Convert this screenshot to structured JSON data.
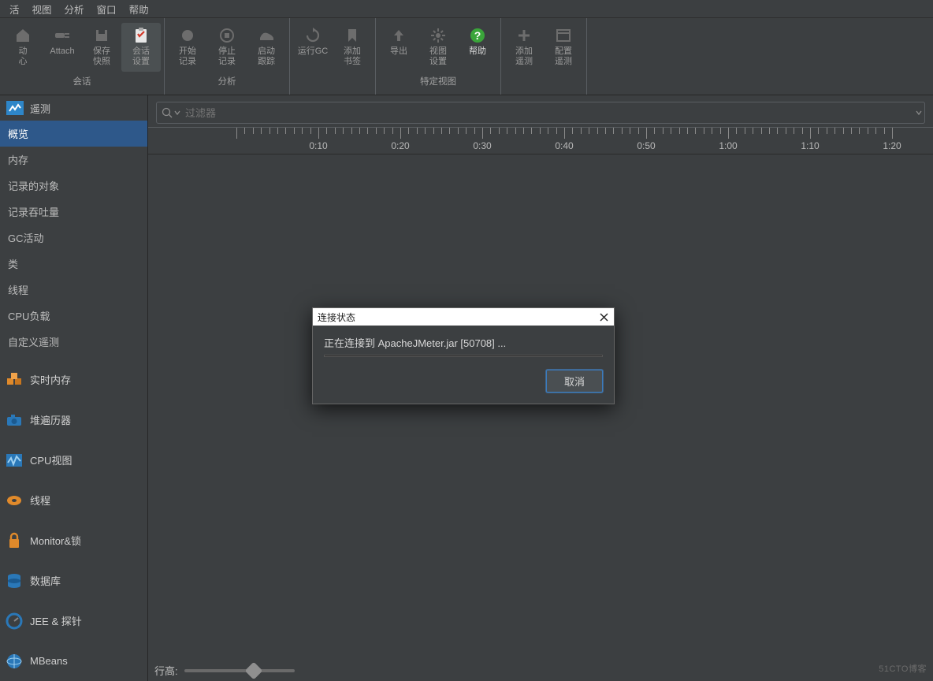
{
  "menu": {
    "items": [
      "活",
      "视图",
      "分析",
      "窗口",
      "帮助"
    ]
  },
  "toolbar": {
    "groups": [
      {
        "label": "会话",
        "buttons": [
          {
            "id": "start-center",
            "l1": "动",
            "l2": "心",
            "icon": "home",
            "sel": false
          },
          {
            "id": "attach",
            "l1": "Attach",
            "l2": "",
            "icon": "plug",
            "sel": false
          },
          {
            "id": "save-snapshot",
            "l1": "保存",
            "l2": "快照",
            "icon": "disk",
            "sel": false
          },
          {
            "id": "session-settings",
            "l1": "会话",
            "l2": "设置",
            "icon": "clipboard",
            "sel": true
          }
        ]
      },
      {
        "label": "分析",
        "buttons": [
          {
            "id": "start-rec",
            "l1": "开始",
            "l2": "记录",
            "icon": "rec",
            "sel": false
          },
          {
            "id": "stop-rec",
            "l1": "停止",
            "l2": "记录",
            "icon": "stop",
            "sel": false
          },
          {
            "id": "start-track",
            "l1": "启动",
            "l2": "跟踪",
            "icon": "shoe",
            "sel": false
          }
        ]
      },
      {
        "label": "",
        "buttons": [
          {
            "id": "run-gc",
            "l1": "运行GC",
            "l2": "",
            "icon": "recycle",
            "sel": false
          },
          {
            "id": "add-bookmark",
            "l1": "添加",
            "l2": "书签",
            "icon": "bookmark",
            "sel": false
          }
        ]
      },
      {
        "label": "特定视图",
        "buttons": [
          {
            "id": "export",
            "l1": "导出",
            "l2": "",
            "icon": "up",
            "sel": false
          },
          {
            "id": "view-settings",
            "l1": "视图",
            "l2": "设置",
            "icon": "gear",
            "sel": false
          },
          {
            "id": "help",
            "l1": "帮助",
            "l2": "",
            "icon": "help",
            "green": true,
            "sel": false
          }
        ]
      },
      {
        "label": "",
        "buttons": [
          {
            "id": "add-telemetry",
            "l1": "添加",
            "l2": "遥测",
            "icon": "plus",
            "sel": false
          },
          {
            "id": "config-telemetry",
            "l1": "配置",
            "l2": "遥测",
            "icon": "window",
            "sel": false
          }
        ]
      }
    ]
  },
  "sidebar": {
    "header": "遥测",
    "items": [
      "概览",
      "内存",
      "记录的对象",
      "记录吞吐量",
      "GC活动",
      "类",
      "线程",
      "CPU负载",
      "自定义遥测"
    ],
    "selectedIndex": 0,
    "bigItems": [
      {
        "id": "live-mem",
        "label": "实时内存",
        "color": "#e08a2b",
        "icon": "cubes"
      },
      {
        "id": "heap-walker",
        "label": "堆遍历器",
        "color": "#2a78b8",
        "icon": "camera"
      },
      {
        "id": "cpu-view",
        "label": "CPU视图",
        "color": "#2a78b8",
        "icon": "pulse"
      },
      {
        "id": "threads",
        "label": "线程",
        "color": "#e08a2b",
        "icon": "disk2"
      },
      {
        "id": "monitor-lock",
        "label": "Monitor&锁",
        "color": "#e08a2b",
        "icon": "lock"
      },
      {
        "id": "database",
        "label": "数据库",
        "color": "#2a78b8",
        "icon": "db"
      },
      {
        "id": "jee-probes",
        "label": "JEE & 探针",
        "color": "#2a78b8",
        "icon": "gauge"
      },
      {
        "id": "mbeans",
        "label": "MBeans",
        "color": "#2a78b8",
        "icon": "globe"
      }
    ]
  },
  "filter": {
    "placeholder": "过滤器"
  },
  "timeline": {
    "labels": [
      "0:10",
      "0:20",
      "0:30",
      "0:40",
      "0:50",
      "1:00",
      "1:10",
      "1:20"
    ]
  },
  "footer": {
    "label": "行高:"
  },
  "dialog": {
    "title": "连接状态",
    "message": "正在连接到 ApacheJMeter.jar [50708] ...",
    "cancel": "取消"
  },
  "watermark": "51CTO博客"
}
